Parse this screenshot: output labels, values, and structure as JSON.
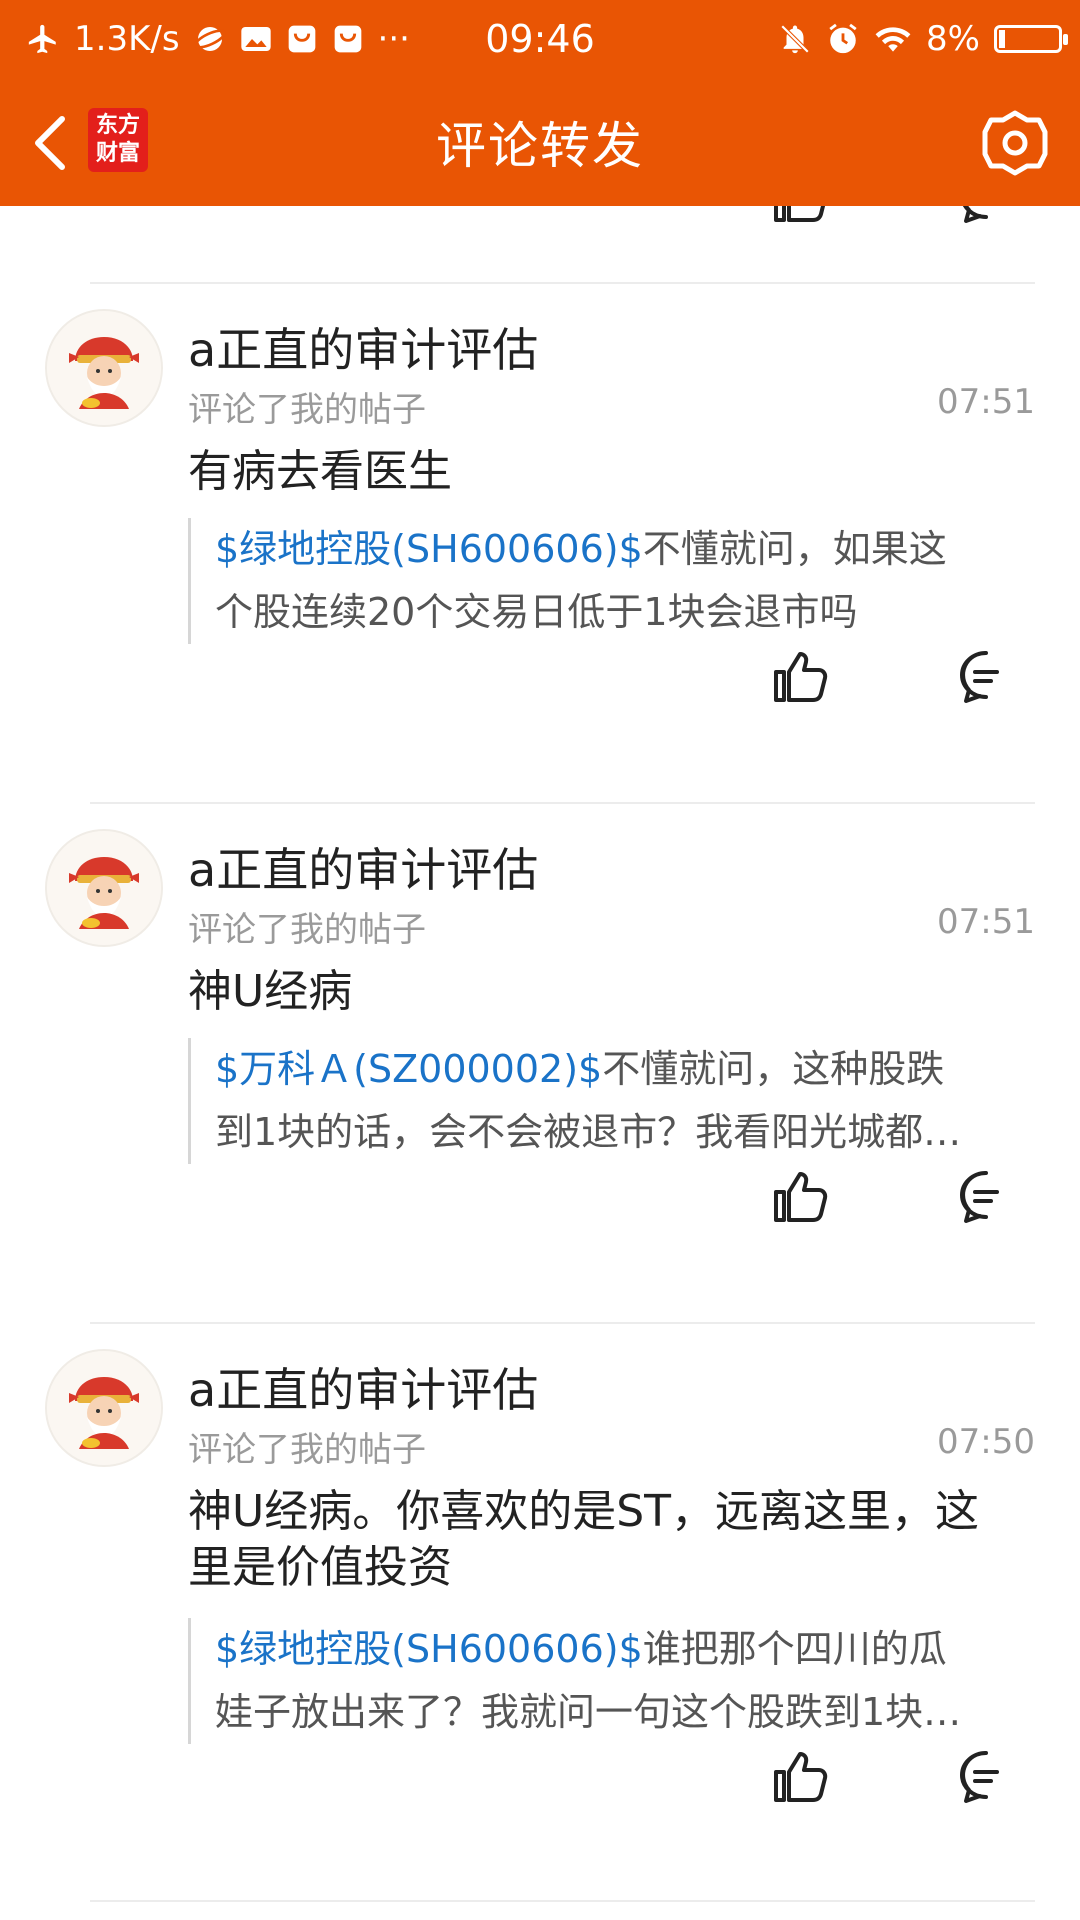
{
  "status_bar": {
    "net_speed": "1.3K/s",
    "more": "···",
    "time": "09:46",
    "battery": "8%"
  },
  "nav": {
    "title": "评论转发",
    "logo_line1": "东方",
    "logo_line2": "财富"
  },
  "colors": {
    "brand_orange": "#e95504",
    "stock_link": "#1a73c8"
  },
  "items": [
    {
      "user": "a正直的审计评估",
      "action": "评论了我的帖子",
      "time": "07:51",
      "comment": "有病去看医生",
      "quote_stock": "$绿地控股(SH600606)$",
      "quote_rest_line1": "不懂就问，如果这",
      "quote_line2": "个股连续20个交易日低于1块会退市吗"
    },
    {
      "user": "a正直的审计评估",
      "action": "评论了我的帖子",
      "time": "07:51",
      "comment": "神U经病",
      "quote_stock": "$万科Ａ(SZ000002)$",
      "quote_rest_line1": "不懂就问，这种股跌",
      "quote_line2": "到1块的话，会不会被退市？我看阳光城都…"
    },
    {
      "user": "a正直的审计评估",
      "action": "评论了我的帖子",
      "time": "07:50",
      "comment": "神U经病。你喜欢的是ST，远离这里，这里是价值投资",
      "quote_stock": "$绿地控股(SH600606)$",
      "quote_rest_line1": "谁把那个四川的瓜",
      "quote_line2": "娃子放出来了？我就问一句这个股跌到1块…"
    }
  ]
}
